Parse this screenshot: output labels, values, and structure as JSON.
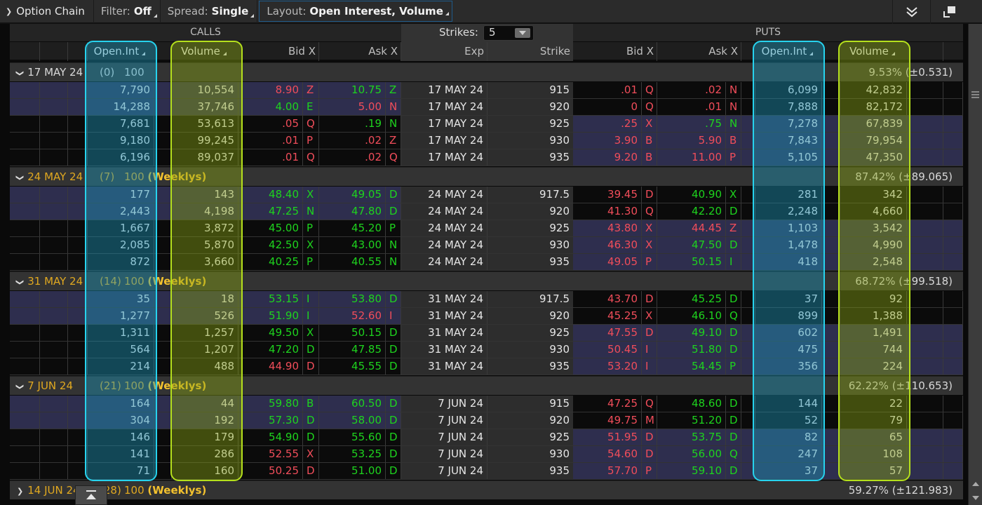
{
  "toolbar": {
    "title": "Option Chain",
    "filter_label": "Filter:",
    "filter_value": "Off",
    "spread_label": "Spread:",
    "spread_value": "Single",
    "layout_label": "Layout:",
    "layout_value": "Open Interest, Volume",
    "icons": {
      "collapse": "chevron-down-icon",
      "menu": "double-chevron-down-icon",
      "popout": "popout-window-icon"
    }
  },
  "header": {
    "calls_label": "CALLS",
    "puts_label": "PUTS",
    "strikes_label": "Strikes:",
    "strikes_value": "5",
    "columns": {
      "calls": {
        "open_int": "Open.Int",
        "volume": "Volume",
        "bid": "Bid X",
        "ask": "Ask X"
      },
      "center": {
        "exp": "Exp",
        "strike": "Strike"
      },
      "puts": {
        "bid": "Bid X",
        "ask": "Ask X",
        "open_int": "Open.Int",
        "volume": "Volume"
      }
    }
  },
  "colors": {
    "up": "#1ed31e",
    "down": "#f04d5a",
    "weekly": "#e0a820",
    "itm": "#2e2e4e",
    "oi_highlight": "#27d3ee",
    "vol_highlight": "#b5e01c"
  },
  "groups": [
    {
      "date": "17 MAY 24",
      "days": "(0)",
      "multiplier": "100",
      "tag": "",
      "weekly": false,
      "expanded": true,
      "iv": "9.53% (±0.531)",
      "rows": [
        {
          "c_oi": "7,790",
          "c_vol": "10,554",
          "c_bid": "8.90",
          "c_bid_dir": "dn",
          "c_bid_ex": "Z",
          "c_ask": "10.75",
          "c_ask_dir": "up",
          "c_ask_ex": "Z",
          "exp": "17 MAY 24",
          "strike": "915",
          "p_bid": ".01",
          "p_bid_dir": "dn",
          "p_bid_ex": "Q",
          "p_ask": ".02",
          "p_ask_dir": "dn",
          "p_ask_ex": "N",
          "p_oi": "6,099",
          "p_vol": "42,832",
          "call_itm": true,
          "put_itm": false
        },
        {
          "c_oi": "14,288",
          "c_vol": "37,746",
          "c_bid": "4.00",
          "c_bid_dir": "up",
          "c_bid_ex": "E",
          "c_ask": "5.00",
          "c_ask_dir": "dn",
          "c_ask_ex": "N",
          "exp": "17 MAY 24",
          "strike": "920",
          "p_bid": "0",
          "p_bid_dir": "dn",
          "p_bid_ex": "Q",
          "p_ask": ".01",
          "p_ask_dir": "dn",
          "p_ask_ex": "N",
          "p_oi": "7,888",
          "p_vol": "82,172",
          "call_itm": true,
          "put_itm": false
        },
        {
          "c_oi": "7,681",
          "c_vol": "53,613",
          "c_bid": ".05",
          "c_bid_dir": "dn",
          "c_bid_ex": "Q",
          "c_ask": ".19",
          "c_ask_dir": "up",
          "c_ask_ex": "N",
          "exp": "17 MAY 24",
          "strike": "925",
          "p_bid": ".25",
          "p_bid_dir": "dn",
          "p_bid_ex": "X",
          "p_ask": ".75",
          "p_ask_dir": "up",
          "p_ask_ex": "N",
          "p_oi": "7,278",
          "p_vol": "67,839",
          "call_itm": false,
          "put_itm": true
        },
        {
          "c_oi": "9,180",
          "c_vol": "99,245",
          "c_bid": ".01",
          "c_bid_dir": "dn",
          "c_bid_ex": "P",
          "c_ask": ".02",
          "c_ask_dir": "dn",
          "c_ask_ex": "Z",
          "exp": "17 MAY 24",
          "strike": "930",
          "p_bid": "3.90",
          "p_bid_dir": "dn",
          "p_bid_ex": "B",
          "p_ask": "5.90",
          "p_ask_dir": "dn",
          "p_ask_ex": "B",
          "p_oi": "7,843",
          "p_vol": "79,954",
          "call_itm": false,
          "put_itm": true
        },
        {
          "c_oi": "6,196",
          "c_vol": "89,037",
          "c_bid": ".01",
          "c_bid_dir": "dn",
          "c_bid_ex": "Q",
          "c_ask": ".02",
          "c_ask_dir": "dn",
          "c_ask_ex": "Q",
          "exp": "17 MAY 24",
          "strike": "935",
          "p_bid": "9.20",
          "p_bid_dir": "dn",
          "p_bid_ex": "B",
          "p_ask": "11.00",
          "p_ask_dir": "dn",
          "p_ask_ex": "P",
          "p_oi": "5,105",
          "p_vol": "47,350",
          "call_itm": false,
          "put_itm": true
        }
      ]
    },
    {
      "date": "24 MAY 24",
      "days": "(7)",
      "multiplier": "100",
      "tag": "(Weeklys)",
      "weekly": true,
      "expanded": true,
      "iv": "87.42% (±89.065)",
      "rows": [
        {
          "c_oi": "177",
          "c_vol": "143",
          "c_bid": "48.40",
          "c_bid_dir": "up",
          "c_bid_ex": "X",
          "c_ask": "49.05",
          "c_ask_dir": "up",
          "c_ask_ex": "D",
          "exp": "24 MAY 24",
          "strike": "917.5",
          "p_bid": "39.45",
          "p_bid_dir": "dn",
          "p_bid_ex": "D",
          "p_ask": "40.90",
          "p_ask_dir": "up",
          "p_ask_ex": "X",
          "p_oi": "281",
          "p_vol": "342",
          "call_itm": true,
          "put_itm": false
        },
        {
          "c_oi": "2,443",
          "c_vol": "4,198",
          "c_bid": "47.25",
          "c_bid_dir": "up",
          "c_bid_ex": "N",
          "c_ask": "47.80",
          "c_ask_dir": "up",
          "c_ask_ex": "D",
          "exp": "24 MAY 24",
          "strike": "920",
          "p_bid": "41.30",
          "p_bid_dir": "dn",
          "p_bid_ex": "Q",
          "p_ask": "42.20",
          "p_ask_dir": "up",
          "p_ask_ex": "D",
          "p_oi": "2,248",
          "p_vol": "4,660",
          "call_itm": true,
          "put_itm": false
        },
        {
          "c_oi": "1,667",
          "c_vol": "3,872",
          "c_bid": "45.00",
          "c_bid_dir": "up",
          "c_bid_ex": "P",
          "c_ask": "45.20",
          "c_ask_dir": "up",
          "c_ask_ex": "P",
          "exp": "24 MAY 24",
          "strike": "925",
          "p_bid": "43.80",
          "p_bid_dir": "dn",
          "p_bid_ex": "X",
          "p_ask": "44.45",
          "p_ask_dir": "dn",
          "p_ask_ex": "Z",
          "p_oi": "1,103",
          "p_vol": "3,542",
          "call_itm": false,
          "put_itm": true
        },
        {
          "c_oi": "2,085",
          "c_vol": "5,870",
          "c_bid": "42.50",
          "c_bid_dir": "up",
          "c_bid_ex": "X",
          "c_ask": "43.00",
          "c_ask_dir": "up",
          "c_ask_ex": "N",
          "exp": "24 MAY 24",
          "strike": "930",
          "p_bid": "46.30",
          "p_bid_dir": "dn",
          "p_bid_ex": "X",
          "p_ask": "47.50",
          "p_ask_dir": "up",
          "p_ask_ex": "D",
          "p_oi": "1,478",
          "p_vol": "4,990",
          "call_itm": false,
          "put_itm": true
        },
        {
          "c_oi": "872",
          "c_vol": "3,660",
          "c_bid": "40.25",
          "c_bid_dir": "up",
          "c_bid_ex": "P",
          "c_ask": "40.55",
          "c_ask_dir": "up",
          "c_ask_ex": "N",
          "exp": "24 MAY 24",
          "strike": "935",
          "p_bid": "49.05",
          "p_bid_dir": "dn",
          "p_bid_ex": "P",
          "p_ask": "50.15",
          "p_ask_dir": "up",
          "p_ask_ex": "I",
          "p_oi": "418",
          "p_vol": "2,548",
          "call_itm": false,
          "put_itm": true
        }
      ]
    },
    {
      "date": "31 MAY 24",
      "days": "(14)",
      "multiplier": "100",
      "tag": "(Weeklys)",
      "weekly": true,
      "expanded": true,
      "iv": "68.72% (±99.518)",
      "rows": [
        {
          "c_oi": "35",
          "c_vol": "18",
          "c_bid": "53.15",
          "c_bid_dir": "up",
          "c_bid_ex": "I",
          "c_ask": "53.80",
          "c_ask_dir": "up",
          "c_ask_ex": "D",
          "exp": "31 MAY 24",
          "strike": "917.5",
          "p_bid": "43.70",
          "p_bid_dir": "dn",
          "p_bid_ex": "D",
          "p_ask": "45.25",
          "p_ask_dir": "up",
          "p_ask_ex": "D",
          "p_oi": "37",
          "p_vol": "92",
          "call_itm": true,
          "put_itm": false
        },
        {
          "c_oi": "1,277",
          "c_vol": "526",
          "c_bid": "51.90",
          "c_bid_dir": "up",
          "c_bid_ex": "I",
          "c_ask": "52.60",
          "c_ask_dir": "dn",
          "c_ask_ex": "I",
          "exp": "31 MAY 24",
          "strike": "920",
          "p_bid": "45.25",
          "p_bid_dir": "dn",
          "p_bid_ex": "X",
          "p_ask": "46.10",
          "p_ask_dir": "up",
          "p_ask_ex": "Q",
          "p_oi": "899",
          "p_vol": "1,388",
          "call_itm": true,
          "put_itm": false
        },
        {
          "c_oi": "1,311",
          "c_vol": "1,257",
          "c_bid": "49.50",
          "c_bid_dir": "up",
          "c_bid_ex": "X",
          "c_ask": "50.15",
          "c_ask_dir": "up",
          "c_ask_ex": "D",
          "exp": "31 MAY 24",
          "strike": "925",
          "p_bid": "47.55",
          "p_bid_dir": "dn",
          "p_bid_ex": "D",
          "p_ask": "49.10",
          "p_ask_dir": "up",
          "p_ask_ex": "D",
          "p_oi": "602",
          "p_vol": "1,491",
          "call_itm": false,
          "put_itm": true
        },
        {
          "c_oi": "564",
          "c_vol": "1,207",
          "c_bid": "47.20",
          "c_bid_dir": "up",
          "c_bid_ex": "D",
          "c_ask": "47.85",
          "c_ask_dir": "up",
          "c_ask_ex": "D",
          "exp": "31 MAY 24",
          "strike": "930",
          "p_bid": "50.45",
          "p_bid_dir": "dn",
          "p_bid_ex": "I",
          "p_ask": "51.80",
          "p_ask_dir": "up",
          "p_ask_ex": "D",
          "p_oi": "475",
          "p_vol": "744",
          "call_itm": false,
          "put_itm": true
        },
        {
          "c_oi": "214",
          "c_vol": "488",
          "c_bid": "44.90",
          "c_bid_dir": "dn",
          "c_bid_ex": "D",
          "c_ask": "45.55",
          "c_ask_dir": "up",
          "c_ask_ex": "D",
          "exp": "31 MAY 24",
          "strike": "935",
          "p_bid": "53.20",
          "p_bid_dir": "dn",
          "p_bid_ex": "I",
          "p_ask": "54.45",
          "p_ask_dir": "up",
          "p_ask_ex": "P",
          "p_oi": "356",
          "p_vol": "224",
          "call_itm": false,
          "put_itm": true
        }
      ]
    },
    {
      "date": "7 JUN 24",
      "days": "(21)",
      "multiplier": "100",
      "tag": "(Weeklys)",
      "weekly": true,
      "expanded": true,
      "iv": "62.22% (±110.653)",
      "rows": [
        {
          "c_oi": "164",
          "c_vol": "44",
          "c_bid": "59.80",
          "c_bid_dir": "up",
          "c_bid_ex": "B",
          "c_ask": "60.50",
          "c_ask_dir": "up",
          "c_ask_ex": "D",
          "exp": "7 JUN 24",
          "strike": "915",
          "p_bid": "47.25",
          "p_bid_dir": "dn",
          "p_bid_ex": "Q",
          "p_ask": "48.60",
          "p_ask_dir": "up",
          "p_ask_ex": "D",
          "p_oi": "144",
          "p_vol": "22",
          "call_itm": true,
          "put_itm": false
        },
        {
          "c_oi": "304",
          "c_vol": "192",
          "c_bid": "57.30",
          "c_bid_dir": "up",
          "c_bid_ex": "D",
          "c_ask": "58.00",
          "c_ask_dir": "up",
          "c_ask_ex": "D",
          "exp": "7 JUN 24",
          "strike": "920",
          "p_bid": "49.75",
          "p_bid_dir": "dn",
          "p_bid_ex": "M",
          "p_ask": "51.20",
          "p_ask_dir": "up",
          "p_ask_ex": "D",
          "p_oi": "52",
          "p_vol": "79",
          "call_itm": true,
          "put_itm": false
        },
        {
          "c_oi": "146",
          "c_vol": "179",
          "c_bid": "54.90",
          "c_bid_dir": "up",
          "c_bid_ex": "D",
          "c_ask": "55.60",
          "c_ask_dir": "up",
          "c_ask_ex": "D",
          "exp": "7 JUN 24",
          "strike": "925",
          "p_bid": "51.95",
          "p_bid_dir": "dn",
          "p_bid_ex": "D",
          "p_ask": "53.75",
          "p_ask_dir": "up",
          "p_ask_ex": "D",
          "p_oi": "82",
          "p_vol": "65",
          "call_itm": false,
          "put_itm": true
        },
        {
          "c_oi": "141",
          "c_vol": "286",
          "c_bid": "52.55",
          "c_bid_dir": "dn",
          "c_bid_ex": "X",
          "c_ask": "53.25",
          "c_ask_dir": "up",
          "c_ask_ex": "D",
          "exp": "7 JUN 24",
          "strike": "930",
          "p_bid": "54.60",
          "p_bid_dir": "dn",
          "p_bid_ex": "D",
          "p_ask": "56.00",
          "p_ask_dir": "up",
          "p_ask_ex": "Q",
          "p_oi": "247",
          "p_vol": "108",
          "call_itm": false,
          "put_itm": true
        },
        {
          "c_oi": "71",
          "c_vol": "160",
          "c_bid": "50.25",
          "c_bid_dir": "dn",
          "c_bid_ex": "D",
          "c_ask": "51.00",
          "c_ask_dir": "up",
          "c_ask_ex": "D",
          "exp": "7 JUN 24",
          "strike": "935",
          "p_bid": "57.70",
          "p_bid_dir": "dn",
          "p_bid_ex": "P",
          "p_ask": "59.10",
          "p_ask_dir": "up",
          "p_ask_ex": "D",
          "p_oi": "37",
          "p_vol": "57",
          "call_itm": false,
          "put_itm": true
        }
      ]
    },
    {
      "date": "14 JUN 24",
      "days": "(28)",
      "multiplier": "100",
      "tag": "(Weeklys)",
      "weekly": true,
      "expanded": false,
      "iv": "59.27% (±121.983)",
      "rows": []
    }
  ],
  "scroll_to_top_icon": "scroll-to-top-icon"
}
